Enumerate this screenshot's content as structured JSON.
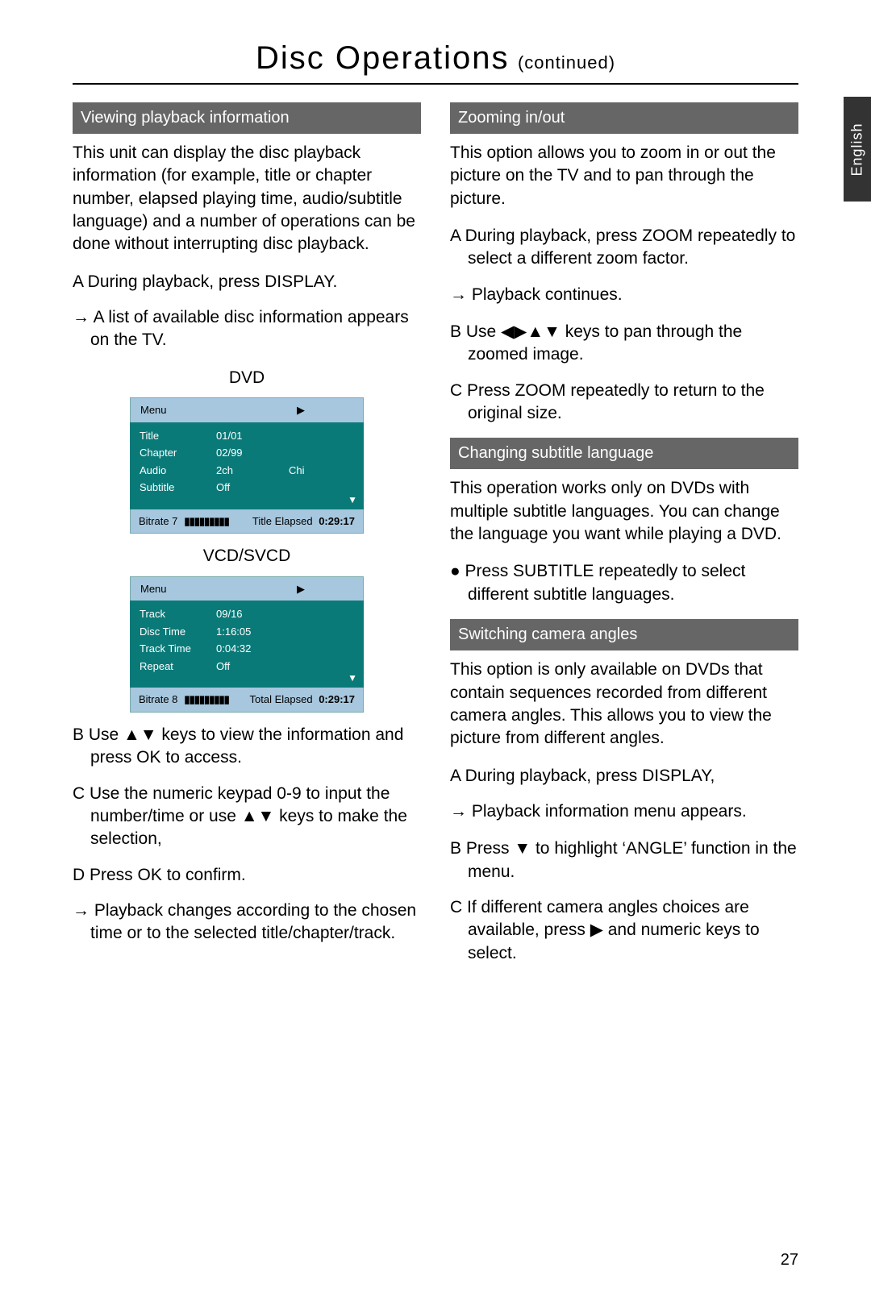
{
  "page": {
    "title": "Disc Operations",
    "continued": "(continued)",
    "language_tab": "English",
    "page_number": "27"
  },
  "left": {
    "section1_title": "Viewing playback information",
    "section1_intro": "This unit can display the disc playback information (for example, title or chapter number, elapsed playing time, audio/subtitle language) and a number of operations can be done without interrupting disc playback.",
    "step1": "A  During playback, press DISPLAY.",
    "step1_sub": "→  A list of available disc information appears on the TV.",
    "dvd_caption": "DVD",
    "vcd_caption": "VCD/SVCD",
    "stepB": "B  Use ▲▼ keys to view the information and press OK to access.",
    "stepC": "C  Use the numeric keypad 0-9 to input the number/time or use ▲▼ keys to make the selection,",
    "stepD": "D  Press OK to confirm.",
    "stepD_sub": "→  Playback changes according to the chosen time or to the selected title/chapter/track."
  },
  "dvd_menu": {
    "menu_label": "Menu",
    "play_glyph": "▶",
    "rows": [
      {
        "k": "Title",
        "v": "01/01",
        "v2": ""
      },
      {
        "k": "Chapter",
        "v": "02/99",
        "v2": ""
      },
      {
        "k": "Audio",
        "v": "2ch",
        "v2": "Chi"
      },
      {
        "k": "Subtitle",
        "v": "Off",
        "v2": ""
      }
    ],
    "down_arrow": "▼",
    "bitrate_label": "Bitrate 7",
    "bars": "▮▮▮▮▮▮▮▮▮",
    "elapsed_label": "Title Elapsed",
    "elapsed_value": "0:29:17"
  },
  "vcd_menu": {
    "menu_label": "Menu",
    "play_glyph": "▶",
    "rows": [
      {
        "k": "Track",
        "v": "09/16",
        "v2": ""
      },
      {
        "k": "Disc Time",
        "v": "1:16:05",
        "v2": ""
      },
      {
        "k": "Track Time",
        "v": "0:04:32",
        "v2": ""
      },
      {
        "k": "Repeat",
        "v": "Off",
        "v2": ""
      }
    ],
    "down_arrow": "▼",
    "bitrate_label": "Bitrate 8",
    "bars": "▮▮▮▮▮▮▮▮▮",
    "elapsed_label": "Total Elapsed",
    "elapsed_value": "0:29:17"
  },
  "right": {
    "zoom_title": "Zooming in/out",
    "zoom_intro": "This option allows you to zoom in or out the picture on the TV and to pan through the picture.",
    "zoom_a": "A  During playback, press ZOOM repeatedly to select a different zoom factor.",
    "zoom_a_sub": "→  Playback continues.",
    "zoom_b": "B  Use ◀▶▲▼ keys to pan through the zoomed image.",
    "zoom_c": "C  Press ZOOM repeatedly to return to the original size.",
    "sub_title": "Changing subtitle language",
    "sub_intro": "This operation works only on DVDs with multiple subtitle languages. You can change the language you want while playing a DVD.",
    "sub_step": "●  Press SUBTITLE repeatedly to select different subtitle languages.",
    "cam_title": "Switching camera angles",
    "cam_intro": "This option is only available on DVDs that contain sequences recorded from different camera angles. This allows you to view the picture from different angles.",
    "cam_a": "A  During playback, press DISPLAY,",
    "cam_a_sub": "→  Playback information menu appears.",
    "cam_b": "B  Press ▼ to highlight ‘ANGLE’ function in the menu.",
    "cam_c": "C  If different camera angles choices are available, press ▶ and numeric keys to select."
  }
}
